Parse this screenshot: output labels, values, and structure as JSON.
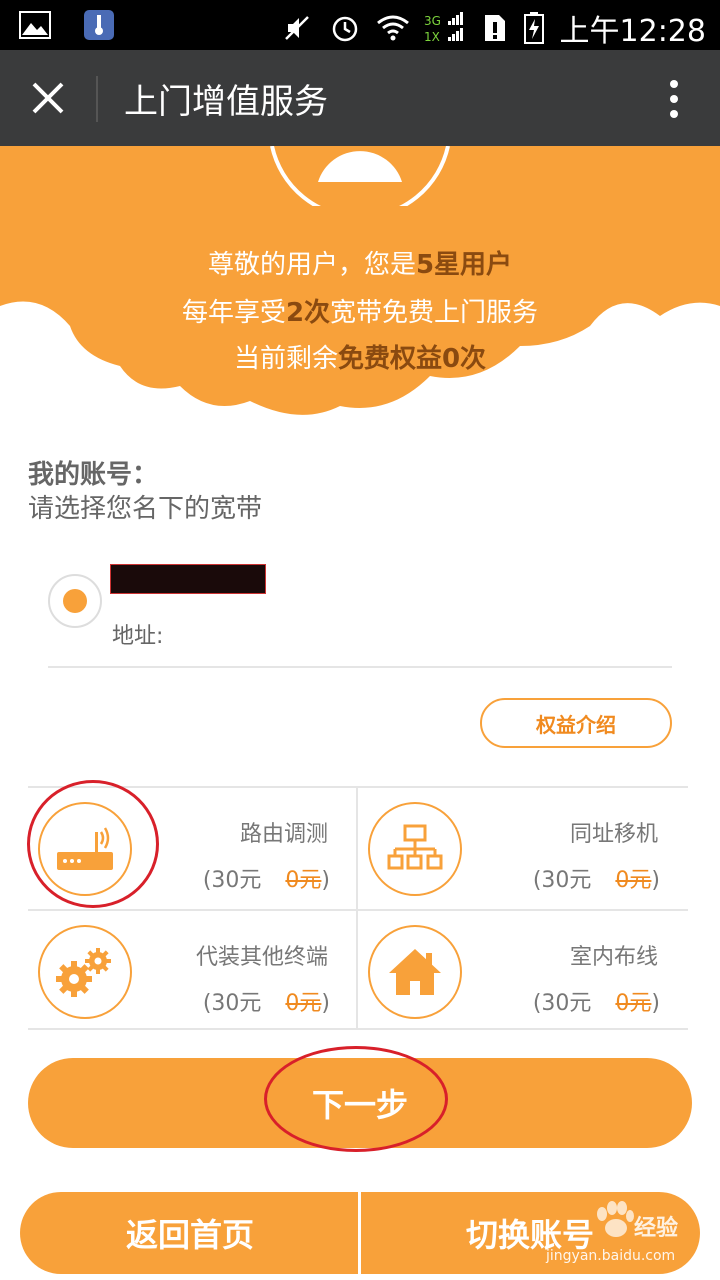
{
  "status_bar": {
    "time": "上午12:28",
    "network": "3G",
    "network2": "1X"
  },
  "header": {
    "title": "上门增值服务"
  },
  "banner": {
    "line1_prefix": "尊敬的用户，您是",
    "line1_highlight": "5星用户",
    "line2_prefix": "每年享受",
    "line2_highlight": "2次",
    "line2_suffix": "宽带免费上门服务",
    "line3_prefix": "当前剩余",
    "line3_highlight": "免费权益0次"
  },
  "account": {
    "title": "我的账号：",
    "subtitle": "请选择您名下的宽带",
    "address_label": "地址:",
    "rights_button": "权益介绍"
  },
  "services": [
    {
      "name": "路由调测",
      "price_prefix": "(30元",
      "price_strike": "0元",
      "price_suffix": ")",
      "icon": "router-icon"
    },
    {
      "name": "同址移机",
      "price_prefix": "(30元",
      "price_strike": "0元",
      "price_suffix": ")",
      "icon": "network-topology-icon"
    },
    {
      "name": "代装其他终端",
      "price_prefix": "(30元",
      "price_strike": "0元",
      "price_suffix": ")",
      "icon": "gears-icon"
    },
    {
      "name": "室内布线",
      "price_prefix": "(30元",
      "price_strike": "0元",
      "price_suffix": ")",
      "icon": "house-icon"
    }
  ],
  "buttons": {
    "next": "下一步",
    "home": "返回首页",
    "switch_account": "切换账号"
  },
  "watermark": {
    "text": "经验",
    "url": "jingyan.baidu.com"
  },
  "colors": {
    "accent": "#f8a13a",
    "titlebar": "#3a3b3c",
    "highlight_text": "#8a4a10"
  }
}
